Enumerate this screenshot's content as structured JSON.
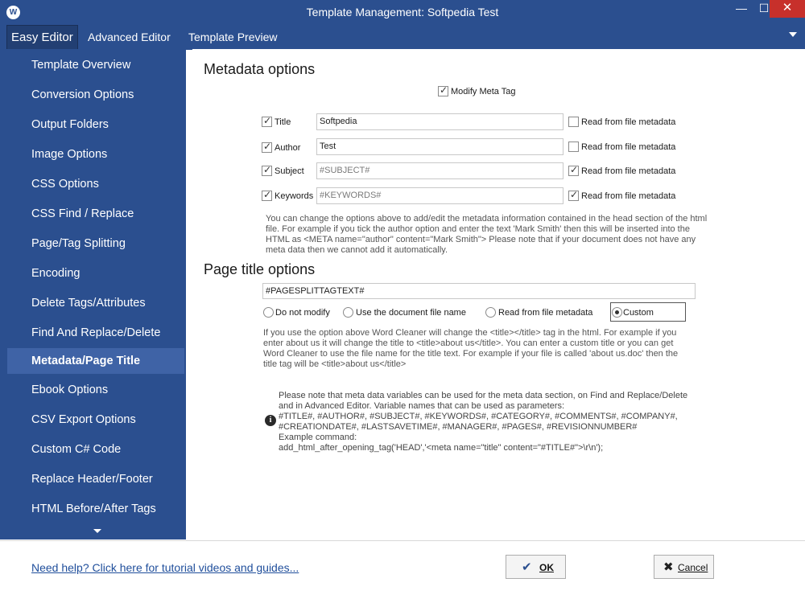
{
  "window": {
    "title": "Template Management: Softpedia Test",
    "app_icon_glyph": "W",
    "controls": {
      "minimize": "—",
      "maximize": "☐",
      "close": "✕"
    }
  },
  "tabs": {
    "easy": "Easy Editor",
    "advanced": "Advanced Editor",
    "preview": "Template Preview"
  },
  "sidebar": {
    "items": [
      {
        "label": "Template Overview"
      },
      {
        "label": "Conversion Options"
      },
      {
        "label": "Output Folders"
      },
      {
        "label": "Image Options"
      },
      {
        "label": "CSS Options"
      },
      {
        "label": "CSS Find / Replace"
      },
      {
        "label": "Page/Tag Splitting"
      },
      {
        "label": "Encoding"
      },
      {
        "label": "Delete Tags/Attributes"
      },
      {
        "label": "Find And Replace/Delete"
      },
      {
        "label": "Metadata/Page Title"
      },
      {
        "label": "Ebook Options"
      },
      {
        "label": "CSV Export Options"
      },
      {
        "label": "Custom C# Code"
      },
      {
        "label": "Replace Header/Footer"
      },
      {
        "label": "HTML Before/After Tags"
      }
    ],
    "active": "Metadata/Page Title"
  },
  "metadata": {
    "heading": "Metadata options",
    "modify_meta_tag": {
      "label": "Modify Meta Tag",
      "checked": true
    },
    "fields": [
      {
        "name": "Title",
        "checked": true,
        "value": "Softpedia",
        "read_from_file": false
      },
      {
        "name": "Author",
        "checked": true,
        "value": "Test",
        "read_from_file": false
      },
      {
        "name": "Subject",
        "checked": true,
        "value": "#SUBJECT#",
        "read_from_file": true
      },
      {
        "name": "Keywords",
        "checked": true,
        "value": "#KEYWORDS#",
        "read_from_file": true
      }
    ],
    "read_from_file_label": "Read from file metadata",
    "help": [
      "You can change the options above to add/edit the metadata information contained in the head section of the html",
      "file. For example if you tick the author option and enter the text 'Mark Smith' then this will be inserted into the",
      "HTML as <META name=\"author\" content=\"Mark Smith\"> Please note that if your document does not have any",
      "meta data then we cannot add it automatically."
    ]
  },
  "page_title": {
    "heading": "Page title options",
    "value": "#PAGESPLITTAGTEXT#",
    "options": [
      {
        "label": "Do not modify",
        "selected": false
      },
      {
        "label": "Use the document file name",
        "selected": false
      },
      {
        "label": "Read from file metadata",
        "selected": false
      },
      {
        "label": "Custom",
        "selected": true
      }
    ],
    "help": [
      "If you use the option above Word Cleaner will change the <title></title> tag in the html. For example if you",
      "enter about us it will change the title to <title>about us</title>. You can enter a custom title or you can get",
      "Word Cleaner to use the file name for the title text. For example if your file is called 'about us.doc' then the",
      "title tag will be <title>about us</title>"
    ]
  },
  "info_note": {
    "lines": [
      "Please note that meta data variables can be used for the  meta data section, on Find and Replace/Delete",
      "and in Advanced Editor. Variable names that can be used as parameters:",
      "#TITLE#, #AUTHOR#, #SUBJECT#, #KEYWORDS#, #CATEGORY#, #COMMENTS#, #COMPANY#,",
      "#CREATIONDATE#, #LASTSAVETIME#, #MANAGER#, #PAGES#, #REVISIONNUMBER#",
      "Example command:",
      "add_html_after_opening_tag('HEAD','<meta name=\"title\" content=\"#TITLE#\">\\r\\n');"
    ],
    "icon_glyph": "i"
  },
  "footer": {
    "help_link": "Need help? Click here for tutorial videos and guides...",
    "ok": "OK",
    "cancel": "Cancel"
  }
}
